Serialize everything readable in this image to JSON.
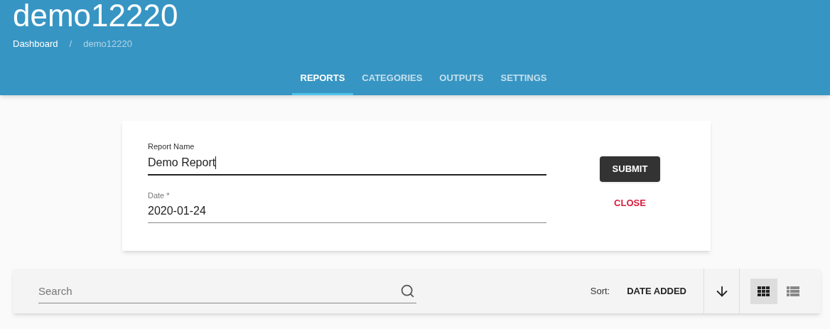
{
  "header": {
    "title": "demo12220",
    "breadcrumb_separator": "/",
    "breadcrumb": [
      {
        "label": "Dashboard",
        "current": false
      },
      {
        "label": "demo12220",
        "current": true
      }
    ]
  },
  "tabs": [
    {
      "label": "REPORTS",
      "selected": true
    },
    {
      "label": "CATEGORIES",
      "selected": false
    },
    {
      "label": "OUTPUTS",
      "selected": false
    },
    {
      "label": "SETTINGS",
      "selected": false
    }
  ],
  "form": {
    "fields": [
      {
        "label": "Report Name",
        "value": "Demo Report",
        "focused": true
      },
      {
        "label": "Date *",
        "value": "2020-01-24",
        "focused": false
      }
    ],
    "submit": "SUBMIT",
    "close": "CLOSE"
  },
  "toolbar": {
    "search": {
      "placeholder": "Search"
    },
    "sort_label": "Sort:",
    "sort_value": "DATE ADDED",
    "views": [
      {
        "kind": "grid",
        "selected": true
      },
      {
        "kind": "list",
        "selected": false
      }
    ]
  }
}
